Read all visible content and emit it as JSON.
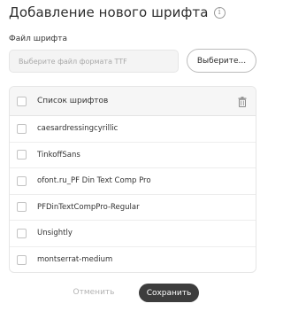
{
  "dialog": {
    "title": "Добавление нового шрифта",
    "info_icon": "ⓘ"
  },
  "file": {
    "label": "Файл шрифта",
    "placeholder": "Выберите файл формата TTF",
    "browse_label": "Выберите..."
  },
  "fonts": {
    "header_label": "Список шрифтов",
    "trash_icon": "trash-icon",
    "items": [
      {
        "label": "caesardressingcyrillic",
        "checked": false
      },
      {
        "label": "TinkoffSans",
        "checked": false
      },
      {
        "label": "ofont.ru_PF Din Text Comp Pro",
        "checked": false
      },
      {
        "label": "PFDinTextCompPro-Regular",
        "checked": false
      },
      {
        "label": "Unsightly",
        "checked": false
      },
      {
        "label": "montserrat-medium",
        "checked": false
      }
    ]
  },
  "actions": {
    "cancel_label": "Отменить",
    "save_label": "Сохранить"
  },
  "colors": {
    "primary_button": "#3d3d3d",
    "disabled_text": "#b3b3b3",
    "header_bg": "#f6f6f6"
  }
}
